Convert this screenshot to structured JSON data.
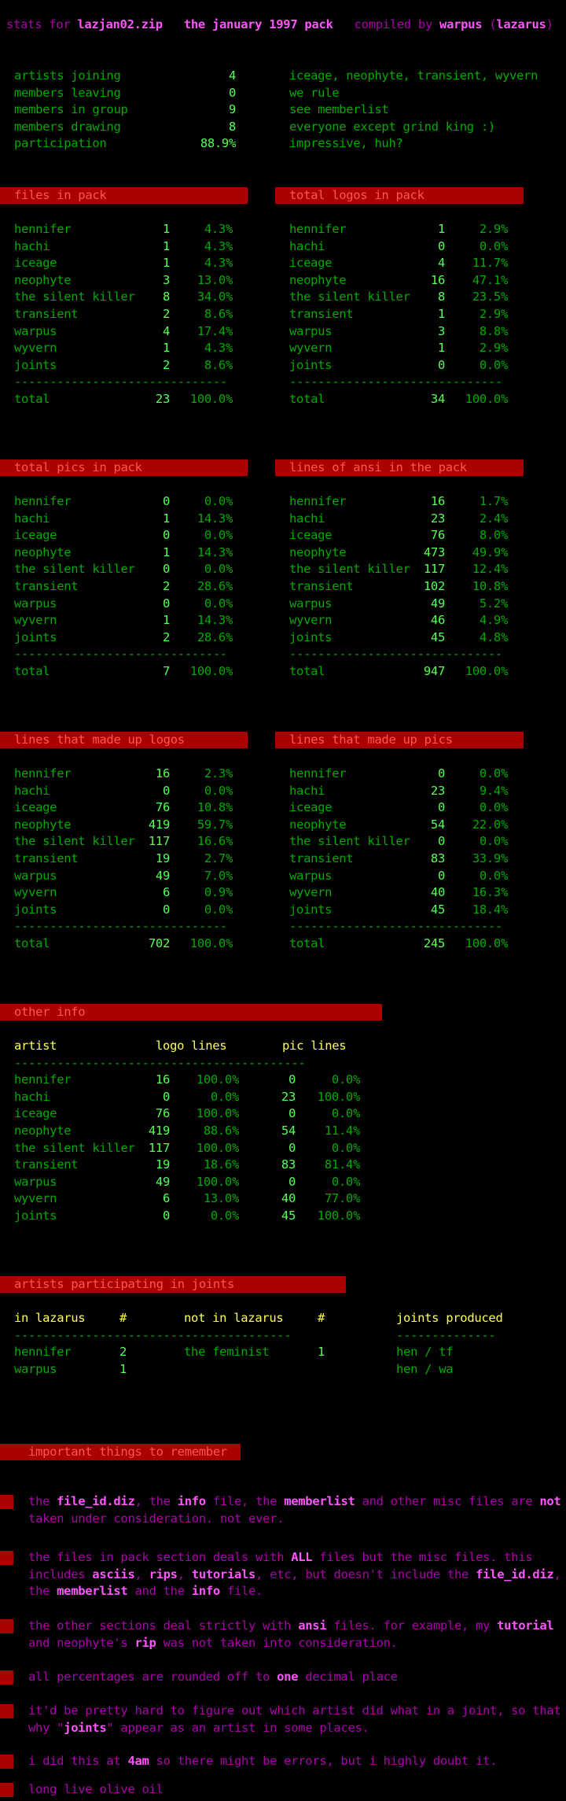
{
  "header": {
    "prefix": "stats for",
    "filename": "lazjan02.zip",
    "pack": "the january 1997 pack",
    "compiled": "compiled by",
    "compiler": "warpus",
    "group_open": "(",
    "group": "lazarus",
    "group_close": ")"
  },
  "summary": [
    {
      "label": "artists joining",
      "value": "4",
      "note": "iceage, neophyte, transient, wyvern"
    },
    {
      "label": "members leaving",
      "value": "0",
      "note": "we rule"
    },
    {
      "label": "members in group",
      "value": "9",
      "note": "see memberlist"
    },
    {
      "label": "members drawing",
      "value": "8",
      "note": "everyone except grind king :)"
    },
    {
      "label": "participation",
      "value": "88.9%",
      "note": "impressive, huh?"
    }
  ],
  "separator": "------------------------------",
  "tables": [
    {
      "title": "files in pack",
      "rows": [
        [
          "hennifer",
          "1",
          "4.3%"
        ],
        [
          "hachi",
          "1",
          "4.3%"
        ],
        [
          "iceage",
          "1",
          "4.3%"
        ],
        [
          "neophyte",
          "3",
          "13.0%"
        ],
        [
          "the silent killer",
          "8",
          "34.0%"
        ],
        [
          "transient",
          "2",
          "8.6%"
        ],
        [
          "warpus",
          "4",
          "17.4%"
        ],
        [
          "wyvern",
          "1",
          "4.3%"
        ],
        [
          "joints",
          "2",
          "8.6%"
        ]
      ],
      "total": [
        "total",
        "23",
        "100.0%"
      ]
    },
    {
      "title": "total logos in pack",
      "rows": [
        [
          "hennifer",
          "1",
          "2.9%"
        ],
        [
          "hachi",
          "0",
          "0.0%"
        ],
        [
          "iceage",
          "4",
          "11.7%"
        ],
        [
          "neophyte",
          "16",
          "47.1%"
        ],
        [
          "the silent killer",
          "8",
          "23.5%"
        ],
        [
          "transient",
          "1",
          "2.9%"
        ],
        [
          "warpus",
          "3",
          "8.8%"
        ],
        [
          "wyvern",
          "1",
          "2.9%"
        ],
        [
          "joints",
          "0",
          "0.0%"
        ]
      ],
      "total": [
        "total",
        "34",
        "100.0%"
      ]
    },
    {
      "title": "total pics in pack",
      "rows": [
        [
          "hennifer",
          "0",
          "0.0%"
        ],
        [
          "hachi",
          "1",
          "14.3%"
        ],
        [
          "iceage",
          "0",
          "0.0%"
        ],
        [
          "neophyte",
          "1",
          "14.3%"
        ],
        [
          "the silent killer",
          "0",
          "0.0%"
        ],
        [
          "transient",
          "2",
          "28.6%"
        ],
        [
          "warpus",
          "0",
          "0.0%"
        ],
        [
          "wyvern",
          "1",
          "14.3%"
        ],
        [
          "joints",
          "2",
          "28.6%"
        ]
      ],
      "total": [
        "total",
        "7",
        "100.0%"
      ]
    },
    {
      "title": "lines of ansi in the pack",
      "rows": [
        [
          "hennifer",
          "16",
          "1.7%"
        ],
        [
          "hachi",
          "23",
          "2.4%"
        ],
        [
          "iceage",
          "76",
          "8.0%"
        ],
        [
          "neophyte",
          "473",
          "49.9%"
        ],
        [
          "the silent killer",
          "117",
          "12.4%"
        ],
        [
          "transient",
          "102",
          "10.8%"
        ],
        [
          "warpus",
          "49",
          "5.2%"
        ],
        [
          "wyvern",
          "46",
          "4.9%"
        ],
        [
          "joints",
          "45",
          "4.8%"
        ]
      ],
      "total": [
        "total",
        "947",
        "100.0%"
      ]
    },
    {
      "title": "lines that made up logos",
      "rows": [
        [
          "hennifer",
          "16",
          "2.3%"
        ],
        [
          "hachi",
          "0",
          "0.0%"
        ],
        [
          "iceage",
          "76",
          "10.8%"
        ],
        [
          "neophyte",
          "419",
          "59.7%"
        ],
        [
          "the silent killer",
          "117",
          "16.6%"
        ],
        [
          "transient",
          "19",
          "2.7%"
        ],
        [
          "warpus",
          "49",
          "7.0%"
        ],
        [
          "wyvern",
          "6",
          "0.9%"
        ],
        [
          "joints",
          "0",
          "0.0%"
        ]
      ],
      "total": [
        "total",
        "702",
        "100.0%"
      ]
    },
    {
      "title": "lines that made up pics",
      "rows": [
        [
          "hennifer",
          "0",
          "0.0%"
        ],
        [
          "hachi",
          "23",
          "9.4%"
        ],
        [
          "iceage",
          "0",
          "0.0%"
        ],
        [
          "neophyte",
          "54",
          "22.0%"
        ],
        [
          "the silent killer",
          "0",
          "0.0%"
        ],
        [
          "transient",
          "83",
          "33.9%"
        ],
        [
          "warpus",
          "0",
          "0.0%"
        ],
        [
          "wyvern",
          "40",
          "16.3%"
        ],
        [
          "joints",
          "45",
          "18.4%"
        ]
      ],
      "total": [
        "total",
        "245",
        "100.0%"
      ]
    }
  ],
  "other_info": {
    "title": "other info",
    "headers": [
      "artist",
      "logo lines",
      "pic lines"
    ],
    "separator": "-----------------------------------------",
    "rows": [
      [
        "hennifer",
        "16",
        "100.0%",
        "0",
        "0.0%"
      ],
      [
        "hachi",
        "0",
        "0.0%",
        "23",
        "100.0%"
      ],
      [
        "iceage",
        "76",
        "100.0%",
        "0",
        "0.0%"
      ],
      [
        "neophyte",
        "419",
        "88.6%",
        "54",
        "11.4%"
      ],
      [
        "the silent killer",
        "117",
        "100.0%",
        "0",
        "0.0%"
      ],
      [
        "transient",
        "19",
        "18.6%",
        "83",
        "81.4%"
      ],
      [
        "warpus",
        "49",
        "100.0%",
        "0",
        "0.0%"
      ],
      [
        "wyvern",
        "6",
        "13.0%",
        "40",
        "77.0%"
      ],
      [
        "joints",
        "0",
        "0.0%",
        "45",
        "100.0%"
      ]
    ]
  },
  "joints": {
    "title": "artists participating in joints",
    "headers": [
      "in lazarus",
      "#",
      "not in lazarus",
      "#",
      "joints produced"
    ],
    "sep_a": "---------------------------------------",
    "sep_b": "--------------",
    "left": [
      [
        "hennifer",
        "2"
      ],
      [
        "warpus",
        "1"
      ]
    ],
    "middle": [
      [
        "the feminist",
        "1"
      ]
    ],
    "produced": [
      "hen / tf",
      "hen / wa"
    ]
  },
  "notes_title": "important things to remember",
  "notes": [
    [
      [
        "the ",
        ""
      ],
      [
        "file_id.diz",
        "b"
      ],
      [
        ", the ",
        ""
      ],
      [
        "info",
        "b"
      ],
      [
        " file, the ",
        ""
      ],
      [
        "memberlist",
        "b"
      ],
      [
        " and other misc files are ",
        ""
      ],
      [
        "not",
        "b"
      ],
      [
        " taken under consideration.  not ever.",
        ""
      ]
    ],
    [
      [
        "the files in pack section deals with ",
        ""
      ],
      [
        "ALL",
        "b"
      ],
      [
        " files but the misc files.  this includes ",
        ""
      ],
      [
        "asciis",
        "b"
      ],
      [
        ", ",
        ""
      ],
      [
        "rips",
        "b"
      ],
      [
        ", ",
        ""
      ],
      [
        "tutorials",
        "b"
      ],
      [
        ", etc, but doesn't include the ",
        ""
      ],
      [
        "file_id.diz",
        "b"
      ],
      [
        ", the ",
        ""
      ],
      [
        "memberlist",
        "b"
      ],
      [
        " and the ",
        ""
      ],
      [
        "info",
        "b"
      ],
      [
        " file.",
        ""
      ]
    ],
    [
      [
        "the other sections deal strictly with ",
        ""
      ],
      [
        "ansi",
        "b"
      ],
      [
        " files.  for example, my ",
        ""
      ],
      [
        "tutorial",
        "b"
      ],
      [
        " and neophyte's ",
        ""
      ],
      [
        "rip",
        "b"
      ],
      [
        " was not taken into consideration.",
        ""
      ]
    ],
    [
      [
        "all percentages are rounded off to ",
        ""
      ],
      [
        "one",
        "b"
      ],
      [
        " decimal place",
        ""
      ]
    ],
    [
      [
        "it'd be pretty hard to figure out which artist did what in a joint, so that why \"",
        ""
      ],
      [
        "joints",
        "b"
      ],
      [
        "\" appear as an artist in some places.",
        ""
      ]
    ],
    [
      [
        "i did this at ",
        ""
      ],
      [
        "4am",
        "b"
      ],
      [
        " so there might be errors, but i highly doubt it.",
        ""
      ]
    ],
    [
      [
        "long live olive oil",
        ""
      ]
    ]
  ]
}
